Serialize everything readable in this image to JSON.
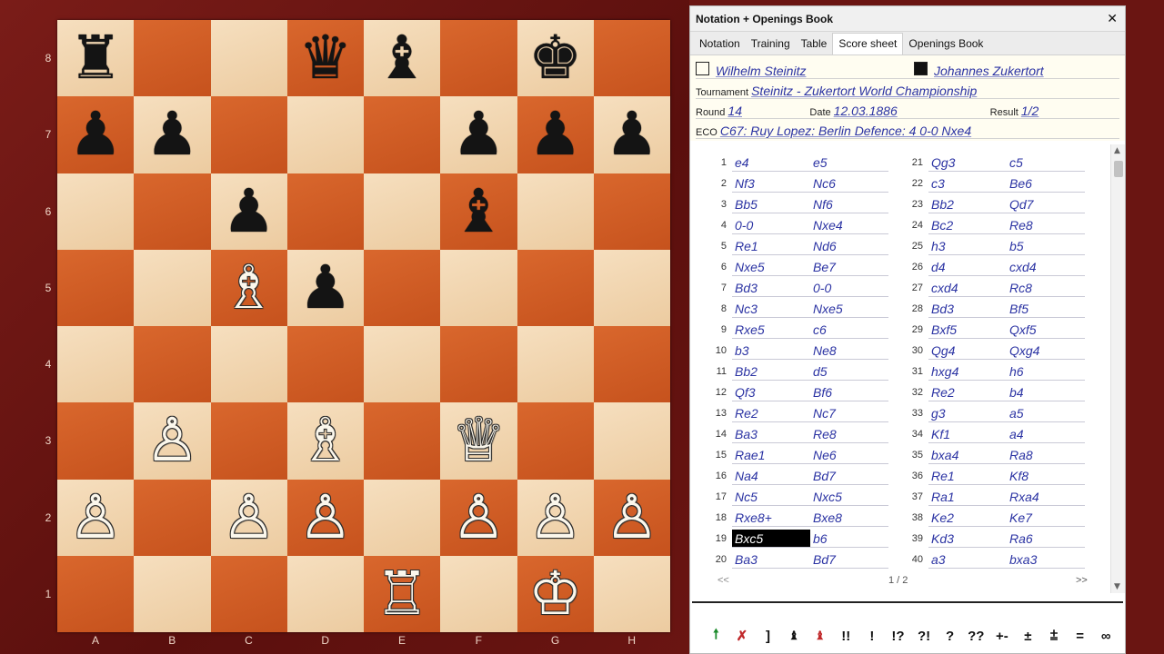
{
  "board": {
    "ranks": [
      "8",
      "7",
      "6",
      "5",
      "4",
      "3",
      "2",
      "1"
    ],
    "files": [
      "A",
      "B",
      "C",
      "D",
      "E",
      "F",
      "G",
      "H"
    ],
    "pieces": [
      {
        "sq": "a8",
        "glyph": "♜",
        "color": "b",
        "name": "black-rook"
      },
      {
        "sq": "d8",
        "glyph": "♛",
        "color": "b",
        "name": "black-queen"
      },
      {
        "sq": "e8",
        "glyph": "♝",
        "color": "b",
        "name": "black-bishop"
      },
      {
        "sq": "g8",
        "glyph": "♚",
        "color": "b",
        "name": "black-king"
      },
      {
        "sq": "a7",
        "glyph": "♟",
        "color": "b",
        "name": "black-pawn"
      },
      {
        "sq": "b7",
        "glyph": "♟",
        "color": "b",
        "name": "black-pawn"
      },
      {
        "sq": "f7",
        "glyph": "♟",
        "color": "b",
        "name": "black-pawn"
      },
      {
        "sq": "g7",
        "glyph": "♟",
        "color": "b",
        "name": "black-pawn"
      },
      {
        "sq": "h7",
        "glyph": "♟",
        "color": "b",
        "name": "black-pawn"
      },
      {
        "sq": "c6",
        "glyph": "♟",
        "color": "b",
        "name": "black-pawn"
      },
      {
        "sq": "f6",
        "glyph": "♝",
        "color": "b",
        "name": "black-bishop"
      },
      {
        "sq": "c5",
        "glyph": "♗",
        "color": "w",
        "name": "white-bishop"
      },
      {
        "sq": "d5",
        "glyph": "♟",
        "color": "b",
        "name": "black-pawn"
      },
      {
        "sq": "b3",
        "glyph": "♙",
        "color": "w",
        "name": "white-pawn"
      },
      {
        "sq": "d3",
        "glyph": "♗",
        "color": "w",
        "name": "white-bishop"
      },
      {
        "sq": "f3",
        "glyph": "♕",
        "color": "w",
        "name": "white-queen"
      },
      {
        "sq": "a2",
        "glyph": "♙",
        "color": "w",
        "name": "white-pawn"
      },
      {
        "sq": "c2",
        "glyph": "♙",
        "color": "w",
        "name": "white-pawn"
      },
      {
        "sq": "d2",
        "glyph": "♙",
        "color": "w",
        "name": "white-pawn"
      },
      {
        "sq": "f2",
        "glyph": "♙",
        "color": "w",
        "name": "white-pawn"
      },
      {
        "sq": "g2",
        "glyph": "♙",
        "color": "w",
        "name": "white-pawn"
      },
      {
        "sq": "h2",
        "glyph": "♙",
        "color": "w",
        "name": "white-pawn"
      },
      {
        "sq": "e1",
        "glyph": "♖",
        "color": "w",
        "name": "white-rook"
      },
      {
        "sq": "g1",
        "glyph": "♔",
        "color": "w",
        "name": "white-king"
      }
    ]
  },
  "panel": {
    "title": "Notation + Openings Book",
    "close": "✕",
    "tabs": [
      "Notation",
      "Training",
      "Table",
      "Score sheet",
      "Openings Book"
    ],
    "active_tab": 3
  },
  "game": {
    "white": "Wilhelm Steinitz",
    "black": "Johannes Zukertort",
    "tournament_label": "Tournament",
    "tournament": "Steinitz - Zukertort World Championship",
    "round_label": "Round",
    "round": "14",
    "date_label": "Date",
    "date": "12.03.1886",
    "result_label": "Result",
    "result": "1/2",
    "eco_label": "ECO",
    "eco": "C67: Ruy Lopez: Berlin Defence: 4 0-0 Nxe4"
  },
  "moves": [
    [
      "e4",
      "e5"
    ],
    [
      "Nf3",
      "Nc6"
    ],
    [
      "Bb5",
      "Nf6"
    ],
    [
      "0-0",
      "Nxe4"
    ],
    [
      "Re1",
      "Nd6"
    ],
    [
      "Nxe5",
      "Be7"
    ],
    [
      "Bd3",
      "0-0"
    ],
    [
      "Nc3",
      "Nxe5"
    ],
    [
      "Rxe5",
      "c6"
    ],
    [
      "b3",
      "Ne8"
    ],
    [
      "Bb2",
      "d5"
    ],
    [
      "Qf3",
      "Bf6"
    ],
    [
      "Re2",
      "Nc7"
    ],
    [
      "Ba3",
      "Re8"
    ],
    [
      "Rae1",
      "Ne6"
    ],
    [
      "Na4",
      "Bd7"
    ],
    [
      "Nc5",
      "Nxc5"
    ],
    [
      "Rxe8+",
      "Bxe8"
    ],
    [
      "Bxc5",
      "b6"
    ],
    [
      "Ba3",
      "Bd7"
    ],
    [
      "Qg3",
      "c5"
    ],
    [
      "c3",
      "Be6"
    ],
    [
      "Bb2",
      "Qd7"
    ],
    [
      "Bc2",
      "Re8"
    ],
    [
      "h3",
      "b5"
    ],
    [
      "d4",
      "cxd4"
    ],
    [
      "cxd4",
      "Rc8"
    ],
    [
      "Bd3",
      "Bf5"
    ],
    [
      "Bxf5",
      "Qxf5"
    ],
    [
      "Qg4",
      "Qxg4"
    ],
    [
      "hxg4",
      "h6"
    ],
    [
      "Re2",
      "b4"
    ],
    [
      "g3",
      "a5"
    ],
    [
      "Kf1",
      "a4"
    ],
    [
      "bxa4",
      "Ra8"
    ],
    [
      "Re1",
      "Kf8"
    ],
    [
      "Ra1",
      "Rxa4"
    ],
    [
      "Ke2",
      "Ke7"
    ],
    [
      "Kd3",
      "Ra6"
    ],
    [
      "a3",
      "bxa3"
    ]
  ],
  "selected_move": {
    "number": 19,
    "side": "white"
  },
  "pager": {
    "prev": "<<",
    "info": "1 / 2",
    "next": ">>"
  },
  "toolbar": [
    {
      "label": "🠕",
      "name": "promote-variation-icon",
      "cls": "green"
    },
    {
      "label": "✗",
      "name": "delete-icon",
      "cls": "red"
    },
    {
      "label": "]",
      "name": "bracket-icon",
      "cls": ""
    },
    {
      "label": "♝",
      "name": "black-piece-icon",
      "cls": "small"
    },
    {
      "label": "♝",
      "name": "red-piece-icon",
      "cls": "small red"
    },
    {
      "label": "!!",
      "name": "brilliant-move-button",
      "cls": ""
    },
    {
      "label": "!",
      "name": "good-move-button",
      "cls": ""
    },
    {
      "label": "!?",
      "name": "interesting-move-button",
      "cls": ""
    },
    {
      "label": "?!",
      "name": "dubious-move-button",
      "cls": ""
    },
    {
      "label": "?",
      "name": "mistake-button",
      "cls": ""
    },
    {
      "label": "??",
      "name": "blunder-button",
      "cls": ""
    },
    {
      "label": "+-",
      "name": "white-winning-button",
      "cls": ""
    },
    {
      "label": "±",
      "name": "white-better-button",
      "cls": ""
    },
    {
      "label": "⩲",
      "name": "white-slightly-better-button",
      "cls": ""
    },
    {
      "label": "=",
      "name": "equal-button",
      "cls": ""
    },
    {
      "label": "∞",
      "name": "unclear-button",
      "cls": ""
    }
  ]
}
